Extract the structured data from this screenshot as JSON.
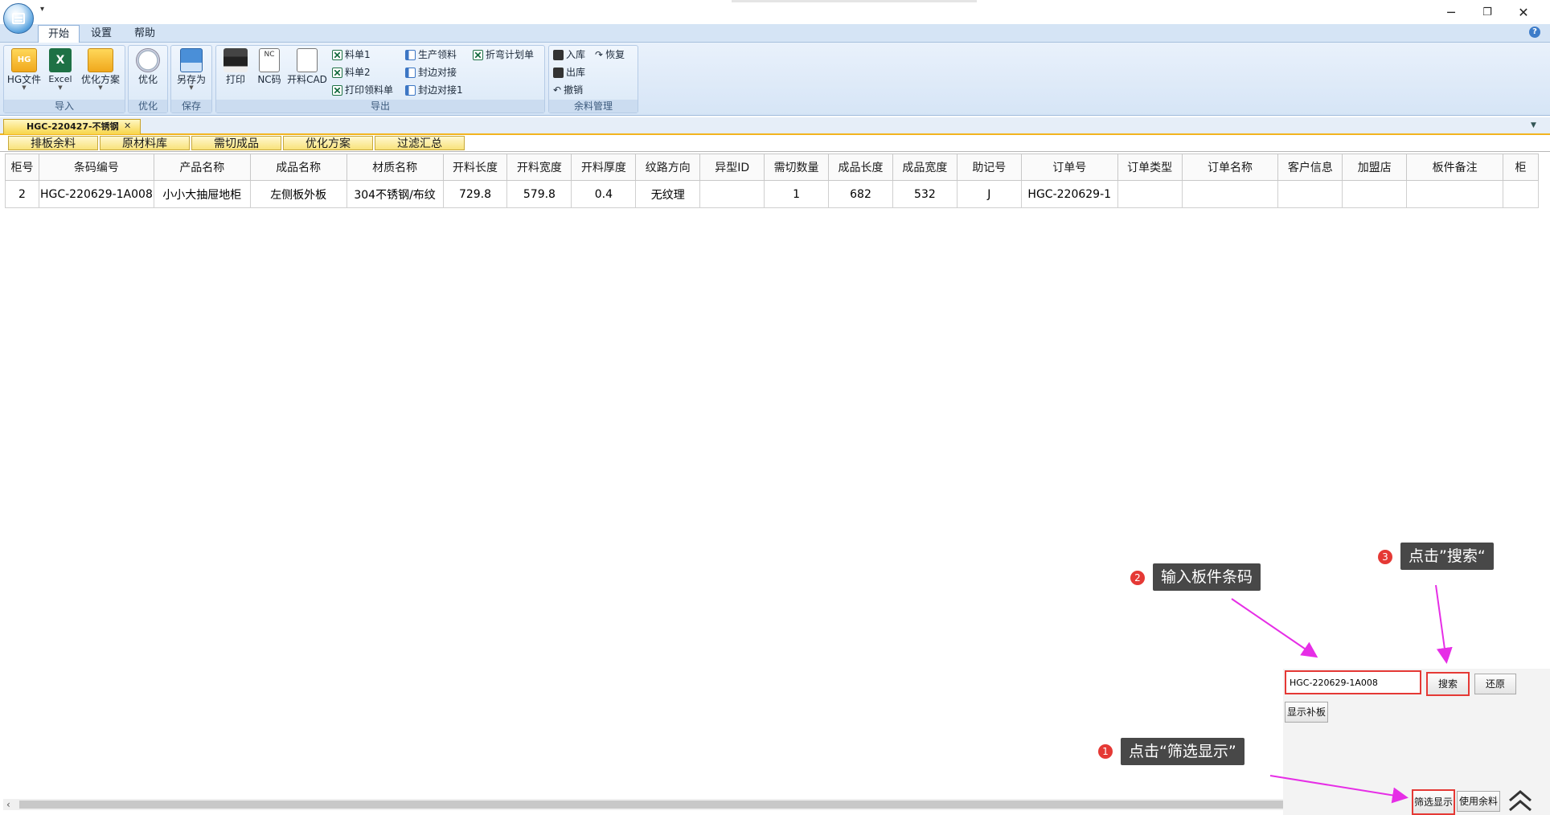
{
  "window": {
    "quick_access": "▾",
    "controls": {
      "minimize": "─",
      "restore": "❐",
      "close": "✕"
    }
  },
  "ribbon_tabs": [
    "开始",
    "设置",
    "帮助"
  ],
  "help_icon": "?",
  "ribbon": {
    "import": {
      "label": "导入",
      "hg_file": "HG文件",
      "excel": "Excel",
      "opt_plan": "优化方案"
    },
    "optimize": {
      "label": "优化",
      "optimize_btn": "优化"
    },
    "save": {
      "label": "保存",
      "save_as": "另存为"
    },
    "export": {
      "label": "导出",
      "print": "打印",
      "nc_code": "NC码",
      "cut_cad": "开料CAD",
      "list1": "料单1",
      "list2": "料单2",
      "print_pick_list": "打印领料单",
      "production_pick": "生产领料",
      "edge_joint": "封边对接",
      "edge_joint1": "封边对接1",
      "bend_plan": "折弯计划单"
    },
    "remnant": {
      "label": "余料管理",
      "in_stock": "入库",
      "restore": "恢复",
      "out_stock": "出库",
      "undo": "撤销"
    }
  },
  "document_tab": {
    "title": "HGC-220427-不锈钢",
    "close": "✕"
  },
  "sub_tabs": [
    "排板余料",
    "原材料库",
    "需切成品",
    "优化方案",
    "过滤汇总"
  ],
  "table": {
    "columns": [
      "柜号",
      "条码编号",
      "产品名称",
      "成品名称",
      "材质名称",
      "开料长度",
      "开料宽度",
      "开料厚度",
      "纹路方向",
      "异型ID",
      "需切数量",
      "成品长度",
      "成品宽度",
      "助记号",
      "订单号",
      "订单类型",
      "订单名称",
      "客户信息",
      "加盟店",
      "板件备注",
      "柜"
    ],
    "rows": [
      [
        "2",
        "HGC-220629-1A008",
        "小小大抽屉地柜",
        "左侧板外板",
        "304不锈钢/布纹",
        "729.8",
        "579.8",
        "0.4",
        "无纹理",
        "",
        "1",
        "682",
        "532",
        "J",
        "HGC-220629-1",
        "",
        "",
        "",
        "",
        "",
        ""
      ]
    ]
  },
  "panel": {
    "search_value": "HGC-220629-1A008",
    "search_button": "搜索",
    "restore_button": "还原",
    "show_patch_button": "显示补板",
    "filter_display_button": "筛选显示",
    "use_remnant_button": "使用余料"
  },
  "annotations": [
    {
      "num": "1",
      "text": "点击“筛选显示”"
    },
    {
      "num": "2",
      "text": "输入板件条码"
    },
    {
      "num": "3",
      "text": "点击”搜索“"
    }
  ],
  "colors": {
    "accent_red": "#e53935",
    "arrow_magenta": "#e62ee6",
    "ribbon_blue": "#d6e5f6",
    "tab_yellow": "#f8e27a"
  }
}
